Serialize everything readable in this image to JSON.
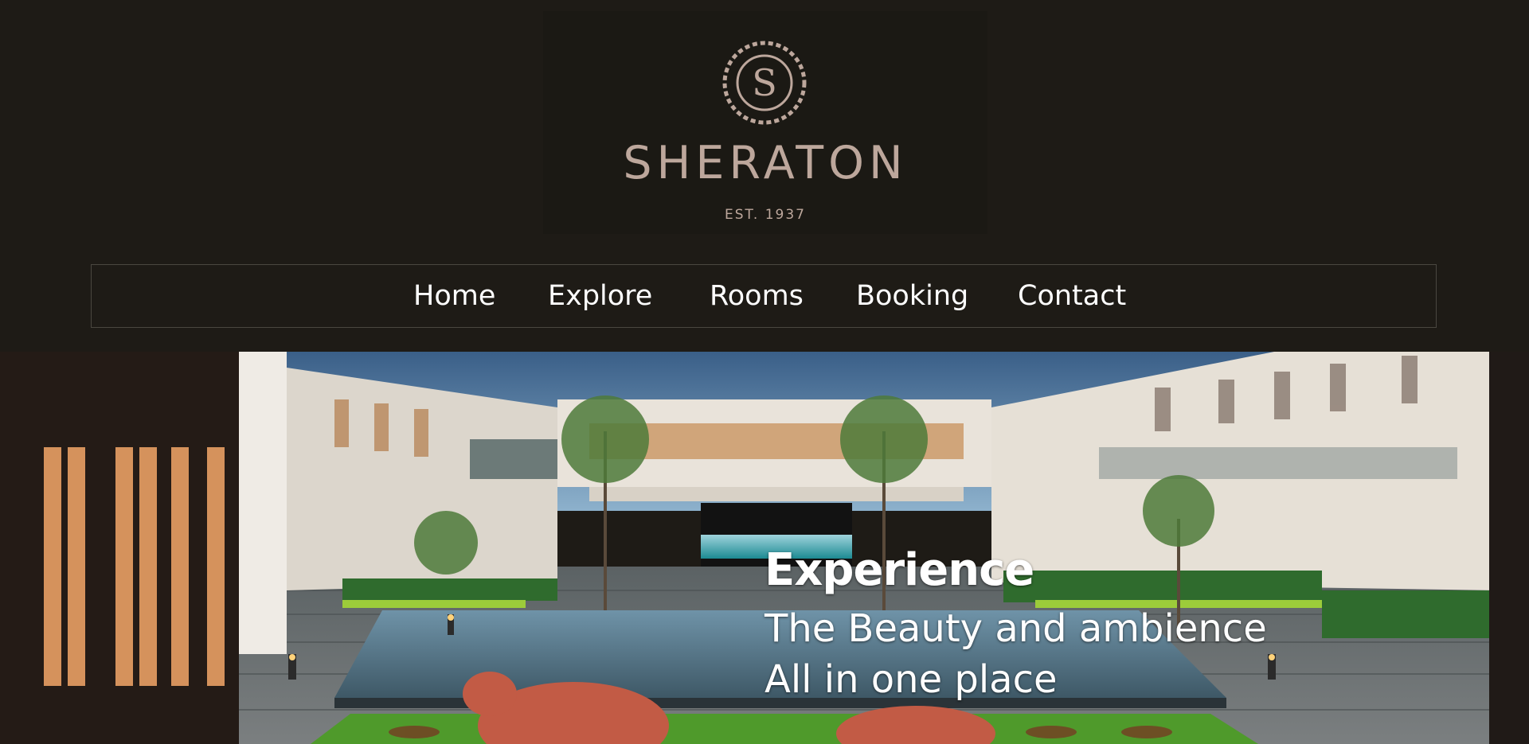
{
  "brand": {
    "name": "SHERATON",
    "established": "EST. 1937",
    "emblem_letter": "S",
    "color": "#bda79c"
  },
  "nav": {
    "items": [
      "Home",
      "Explore",
      "Rooms",
      "Booking",
      "Contact"
    ]
  },
  "hero": {
    "title": "Experience",
    "line1": "The Beauty and ambience",
    "line2": "All in one place",
    "image": "resort-courtyard-pool-photo"
  },
  "colors": {
    "background": "#1e1b16",
    "nav_border": "#4a4740",
    "nav_text": "#ffffff"
  }
}
